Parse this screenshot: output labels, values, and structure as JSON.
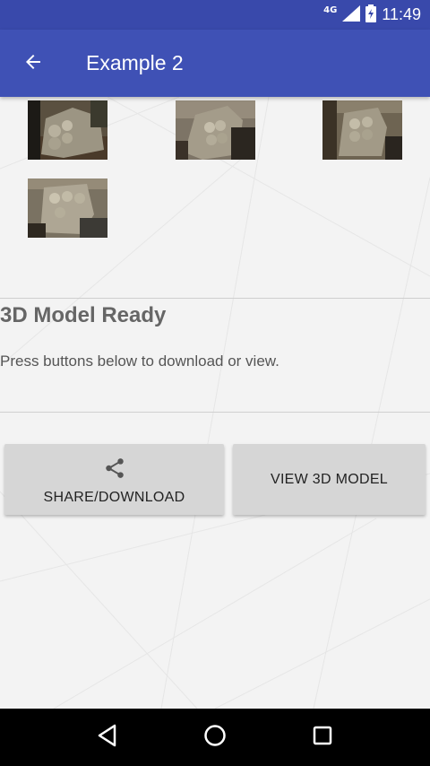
{
  "status_bar": {
    "network": "4G",
    "time": "11:49"
  },
  "app_bar": {
    "title": "Example 2",
    "back_icon": "arrow-left-icon"
  },
  "gallery": {
    "images": [
      {
        "name": "photo-1"
      },
      {
        "name": "photo-2"
      },
      {
        "name": "photo-3"
      },
      {
        "name": "photo-4"
      }
    ]
  },
  "result": {
    "heading": "3D Model Ready",
    "message": "Press buttons below to download or view."
  },
  "actions": {
    "share_label": "SHARE/DOWNLOAD",
    "share_icon": "share-icon",
    "view_label": "VIEW 3D MODEL"
  },
  "nav": {
    "back_icon": "triangle-back-icon",
    "home_icon": "circle-home-icon",
    "recents_icon": "square-recents-icon"
  },
  "colors": {
    "primary": "#3f51b5",
    "primary_dark": "#3949ab",
    "button_bg": "#d6d6d6"
  }
}
